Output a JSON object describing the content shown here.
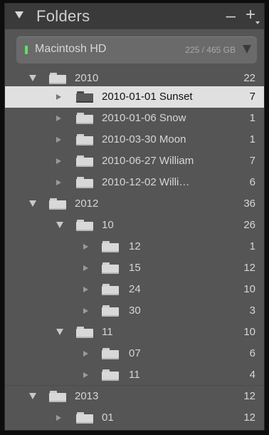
{
  "panel": {
    "title": "Folders",
    "minus": "–",
    "plus": "+"
  },
  "volume": {
    "name": "Macintosh HD",
    "usage": "225 / 465 GB",
    "status_color": "#5ee06a"
  },
  "tree": [
    {
      "label": "2010",
      "count": "22",
      "expanded": true
    },
    {
      "label": "2010-01-01 Sunset",
      "count": "7",
      "expanded": false,
      "selected": true
    },
    {
      "label": "2010-01-06 Snow",
      "count": "1",
      "expanded": false
    },
    {
      "label": "2010-03-30 Moon",
      "count": "1",
      "expanded": false
    },
    {
      "label": "2010-06-27 William",
      "count": "7",
      "expanded": false
    },
    {
      "label": "2010-12-02 Willi…",
      "count": "6",
      "expanded": false
    },
    {
      "label": "2012",
      "count": "36",
      "expanded": true
    },
    {
      "label": "10",
      "count": "26",
      "expanded": true
    },
    {
      "label": "12",
      "count": "1",
      "expanded": false
    },
    {
      "label": "15",
      "count": "12",
      "expanded": false
    },
    {
      "label": "24",
      "count": "10",
      "expanded": false
    },
    {
      "label": "30",
      "count": "3",
      "expanded": false
    },
    {
      "label": "11",
      "count": "10",
      "expanded": true
    },
    {
      "label": "07",
      "count": "6",
      "expanded": false
    },
    {
      "label": "11",
      "count": "4",
      "expanded": false
    },
    {
      "label": "2013",
      "count": "12",
      "expanded": true
    },
    {
      "label": "01",
      "count": "12",
      "expanded": false
    }
  ]
}
